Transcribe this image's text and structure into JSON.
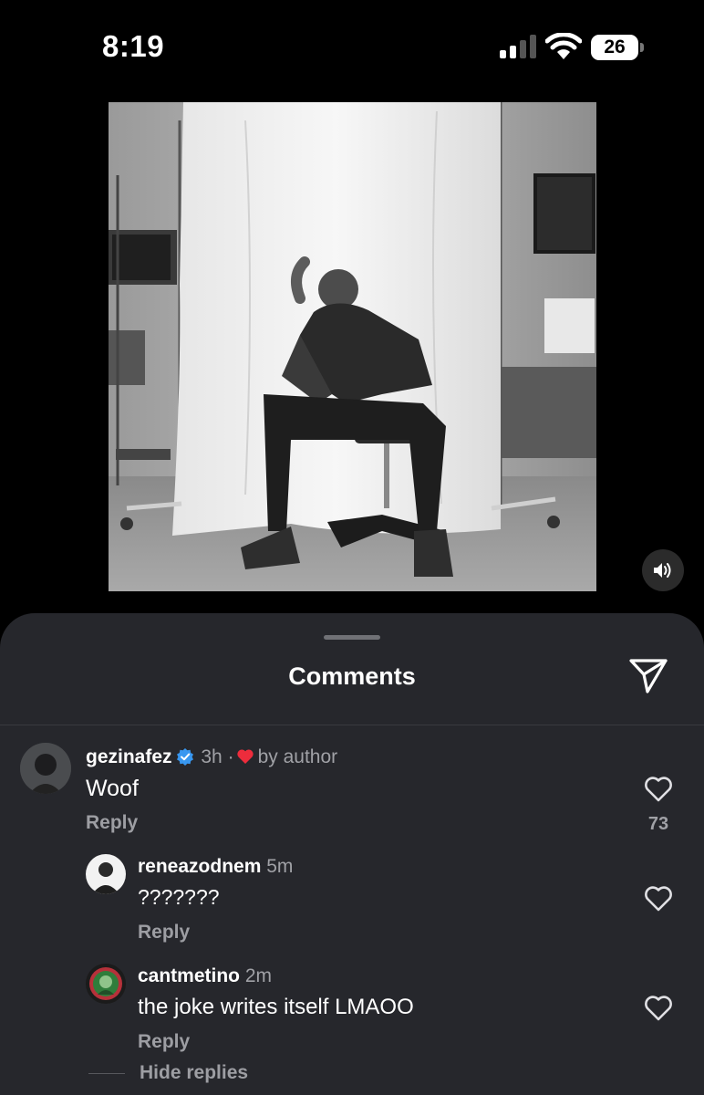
{
  "status_bar": {
    "time": "8:19",
    "battery": "26"
  },
  "post": {
    "image_alt": "Black and white photo of a man in scrubs sitting on a stool in front of a white sheet in a hospital room",
    "sound_icon": "speaker-icon"
  },
  "sheet": {
    "title": "Comments",
    "share_icon": "paper-plane-icon",
    "hide_replies": "Hide replies"
  },
  "comments": [
    {
      "username": "gezinafez",
      "verified": true,
      "time": "3h",
      "separator": "·",
      "liked_by_author": "by author",
      "text": "Woof",
      "reply_label": "Reply",
      "like_count": "73"
    },
    {
      "username": "reneazodnem",
      "time": "5m",
      "text": "???????",
      "reply_label": "Reply"
    },
    {
      "username": "cantmetino",
      "time": "2m",
      "text": "the joke writes itself LMAOO",
      "reply_label": "Reply"
    }
  ],
  "colors": {
    "sheet_bg": "#26272c",
    "verified_blue": "#3897f0",
    "heart_red": "#ed2c3c",
    "secondary_text": "#a0a1a6"
  }
}
